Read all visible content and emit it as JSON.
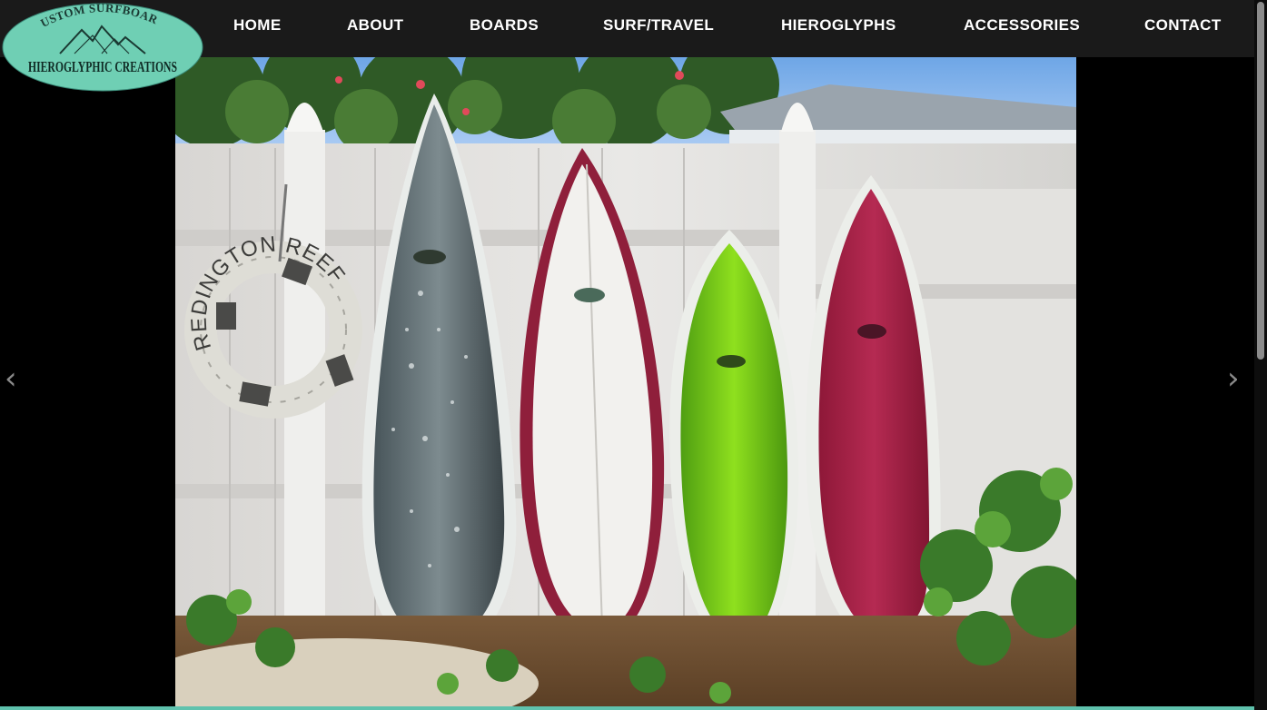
{
  "brand": {
    "top_text": "CUSTOM SURFBOARDS",
    "bottom_text": "HIEROGLYPHIC CREATIONS",
    "logo_color": "#6fcfb4"
  },
  "nav": {
    "items": [
      {
        "label": "HOME"
      },
      {
        "label": "ABOUT"
      },
      {
        "label": "BOARDS"
      },
      {
        "label": "SURF/TRAVEL"
      },
      {
        "label": "HIEROGLYPHS"
      },
      {
        "label": "ACCESSORIES"
      },
      {
        "label": "CONTACT"
      }
    ]
  },
  "hero": {
    "life_ring_text": "REDINGTON REEF"
  },
  "slider": {
    "prev_icon": "‹",
    "next_icon": "›"
  },
  "colors": {
    "accent": "#5fc2ad",
    "header_bg": "#1a1a1a"
  }
}
